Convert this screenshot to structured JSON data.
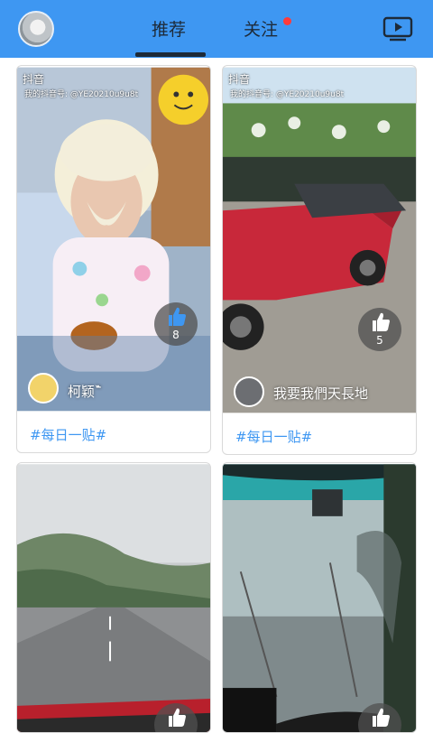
{
  "header": {
    "tabs": [
      {
        "label": "推荐",
        "active": true
      },
      {
        "label": "关注",
        "has_notification_dot": true
      }
    ],
    "right_icon": "tv-play-icon",
    "background": "#3e97f2"
  },
  "cards": [
    {
      "app_logo": "抖音",
      "watermark_id": "我的抖音号: @YE20210u9u8t",
      "likes": "8",
      "user_name": "柯颖ˆ᷅",
      "tag": "#每日一贴#",
      "like_icon": "thumbs-up-icon"
    },
    {
      "app_logo": "抖音",
      "watermark_id": "我的抖音号: @YE20210u9u8t",
      "likes": "5",
      "user_name": "我要我們天長地",
      "tag": "#每日一贴#",
      "like_icon": "thumbs-up-icon"
    },
    {
      "like_icon": "thumbs-up-icon"
    },
    {
      "like_icon": "thumbs-up-icon"
    }
  ],
  "colors": {
    "accent": "#3e97f2",
    "tag": "#3e97f2",
    "dot": "#ff3b3b"
  }
}
